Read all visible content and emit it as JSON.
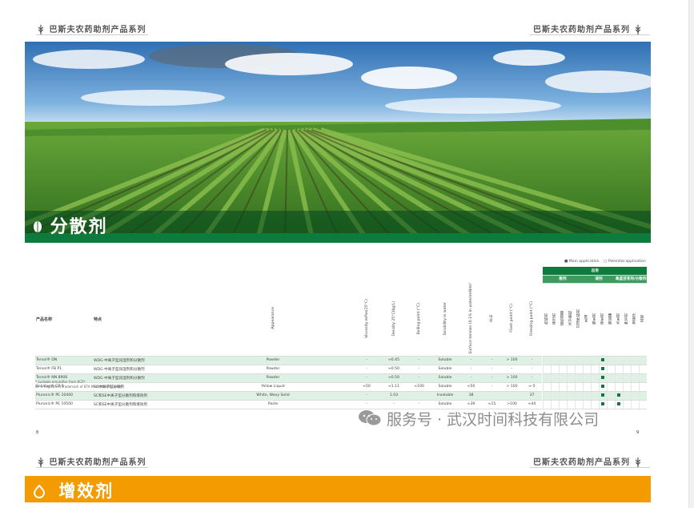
{
  "brand": {
    "top_left": "巴斯夫农药助剂产品系列",
    "top_right": "巴斯夫农药助剂产品系列",
    "bottom_left": "巴斯夫农药助剂产品系列",
    "bottom_right": "巴斯夫农药助剂产品系列"
  },
  "section": {
    "title": "分散剂",
    "next_title": "增效剂"
  },
  "legend": {
    "main": "■ Main application",
    "potential": "□ Potential application"
  },
  "table": {
    "col_product": "产品名称",
    "col_feature": "特点",
    "col_appearance": "Appearance",
    "col_viscosity": "Viscosity mPas(25°C)",
    "col_density": "Density 25°C(kg/L)",
    "col_boiling": "Boiling point (°C)",
    "col_solubility": "Solubility in water",
    "col_surface": "Surface tension (0.1% in water)mN/m²",
    "col_hlb": "HLB",
    "col_flash": "Flash point (°C)",
    "col_freezing": "Freezing point (°C)",
    "group_apps": "应用",
    "group_disp": "散剂",
    "group_liquid": "液剂",
    "group_other": "桑蓝芸苍刑/分散剂",
    "app_cols": [
      "粒粉剂",
      "悬浮剂",
      "超低容量",
      "水分散粒",
      "可湿性粉剂",
      "乳油",
      "微乳剂",
      "悬乳剂",
      "微胶囊",
      "水乳剂",
      "种衣剂",
      "油悬浮",
      "其他"
    ],
    "rows": [
      {
        "product": "Tersol® DN",
        "feature": "WDG 中离子型润湿剂和分散剂",
        "appearance": "Powder",
        "viscosity": "-",
        "density": "≈0.45",
        "boiling": "-",
        "solubility": "Soluble",
        "surface": "-",
        "hlb": "-",
        "flash": "> 100",
        "freezing": "-",
        "marks": [
          7
        ]
      },
      {
        "product": "Tersol® FB P1",
        "feature": "WDG 中离子型润湿剂和分散剂",
        "appearance": "Powder",
        "viscosity": "-",
        "density": "≈0.50",
        "boiling": "-",
        "solubility": "Soluble",
        "surface": "-",
        "hlb": "-",
        "flash": "-",
        "freezing": "-",
        "marks": [
          7
        ]
      },
      {
        "product": "Tersol® NN 8906",
        "feature": "WDG 中离子型润湿剂和分散剂",
        "appearance": "Powder",
        "viscosity": "-",
        "density": "≈0.50",
        "boiling": "-",
        "solubility": "Soluble",
        "surface": "-",
        "hlb": "-",
        "flash": "> 100",
        "freezing": "-",
        "marks": [
          7
        ]
      },
      {
        "product": "Sokalan® CP 9",
        "feature": "SC中离子型分散剂",
        "appearance": "Yellow Liquid",
        "viscosity": "≈50",
        "density": "≈1.11",
        "boiling": "≈100",
        "solubility": "Soluble",
        "surface": "≈50",
        "hlb": "-",
        "flash": "> 100",
        "freezing": "≈-5",
        "marks": [
          7
        ]
      },
      {
        "product": "Pluronic® PE 10400",
        "feature": "SC和SE中离子型分散剂和增效剂",
        "appearance": "White, Waxy Solid",
        "viscosity": "-",
        "density": "1.03",
        "boiling": "",
        "solubility": "Insoluble",
        "surface": "38",
        "hlb": "",
        "flash": "",
        "freezing": "37",
        "marks": [
          7,
          9
        ]
      },
      {
        "product": "Pluronic® PE 10500",
        "feature": "SC和SE中离子型分散剂和增效剂",
        "appearance": "Paste",
        "viscosity": "-",
        "density": "-",
        "boiling": "-",
        "solubility": "Soluble",
        "surface": "≈39",
        "hlb": "≈15",
        "flash": ">100",
        "freezing": "≈44",
        "marks": [
          7,
          9
        ]
      }
    ]
  },
  "footnotes": [
    "* Suitable emulsifier from BCR*",
    "BY = Registered trademark of BTA Masterbatch GmbH"
  ],
  "page_numbers": {
    "left": "8",
    "right": "9"
  },
  "watermark": "服务号 · 武汉时间科技有限公司",
  "colors": {
    "green": "#0e7a3c",
    "orange": "#f39b00",
    "row_tint": "#dff0e4"
  }
}
